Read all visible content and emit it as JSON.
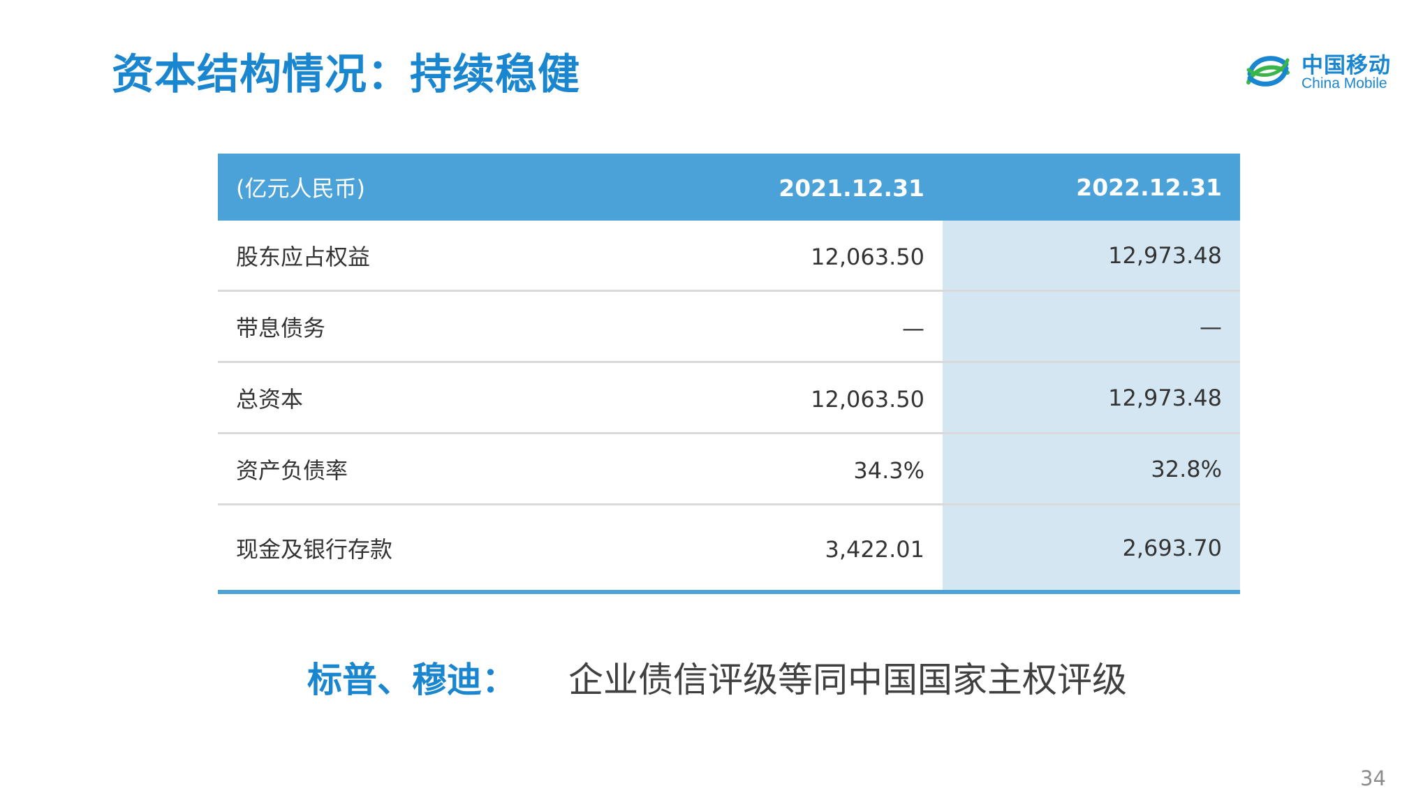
{
  "title": "资本结构情况：持续稳健",
  "logo": {
    "cn": "中国移动",
    "en": "China Mobile",
    "color": "#1a86d0"
  },
  "table": {
    "header": {
      "unit": "(亿元人民币)",
      "col1": "2021.12.31",
      "col2": "2022.12.31"
    },
    "rows": [
      {
        "label": "股东应占权益",
        "v2021": "12,063.50",
        "v2022": "12,973.48"
      },
      {
        "label": "带息债务",
        "v2021": "—",
        "v2022": "—"
      },
      {
        "label": "总资本",
        "v2021": "12,063.50",
        "v2022": "12,973.48"
      },
      {
        "label": "资产负债率",
        "v2021": "34.3%",
        "v2022": "32.8%"
      },
      {
        "label": "现金及银行存款",
        "v2021": "3,422.01",
        "v2022": "2,693.70"
      }
    ]
  },
  "note": {
    "label": "标普、穆迪：",
    "text": "企业债信评级等同中国国家主权评级"
  },
  "page_number": "34"
}
